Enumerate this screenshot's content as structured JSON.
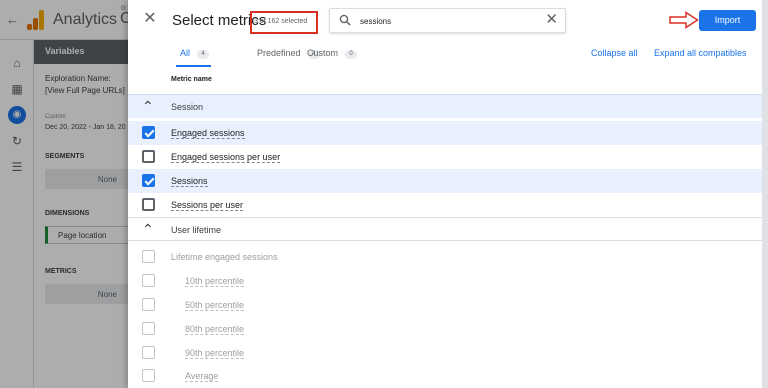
{
  "background": {
    "app_name": "Analytics",
    "app_name_extra_top": "G",
    "app_name_extra": "C",
    "variables_header": "Variables",
    "exploration_label": "Exploration Name:",
    "exploration_value": "[View Full Page URLs]",
    "date_caption": "Custom",
    "date_range": "Dec 20, 2022 - Jan 18, 20",
    "segments_label": "SEGMENTS",
    "segments_value": "None",
    "dimensions_label": "DIMENSIONS",
    "dimension_item": "Page location",
    "metrics_label": "METRICS",
    "metrics_value": "None"
  },
  "modal": {
    "title": "Select metrics",
    "selected_count": "3 of 162 selected",
    "search": {
      "value": "sessions",
      "placeholder": "Search"
    },
    "import_label": "Import",
    "tabs": [
      {
        "label": "All",
        "count": "4"
      },
      {
        "label": "Predefined",
        "count": "4"
      },
      {
        "label": "Custom",
        "count": "0"
      }
    ],
    "collapse_all": "Collapse all",
    "expand_all_compatibles": "Expand all compatibles",
    "column_header": "Metric name",
    "groups": [
      {
        "label": "Session",
        "items": [
          {
            "label": "Engaged sessions",
            "checked": true
          },
          {
            "label": "Engaged sessions per user",
            "checked": false
          },
          {
            "label": "Sessions",
            "checked": true
          },
          {
            "label": "Sessions per user",
            "checked": false
          }
        ]
      },
      {
        "label": "User lifetime",
        "items": [
          {
            "label": "Lifetime engaged sessions",
            "disabled": true
          },
          {
            "label": "10th percentile",
            "disabled": true
          },
          {
            "label": "50th percentile",
            "disabled": true
          },
          {
            "label": "80th percentile",
            "disabled": true
          },
          {
            "label": "90th percentile",
            "disabled": true
          },
          {
            "label": "Average",
            "disabled": true
          }
        ]
      }
    ]
  },
  "colors": {
    "accent": "#1a73e8",
    "highlight_row": "#e8f0fe",
    "annotation_red": "#d93025"
  }
}
